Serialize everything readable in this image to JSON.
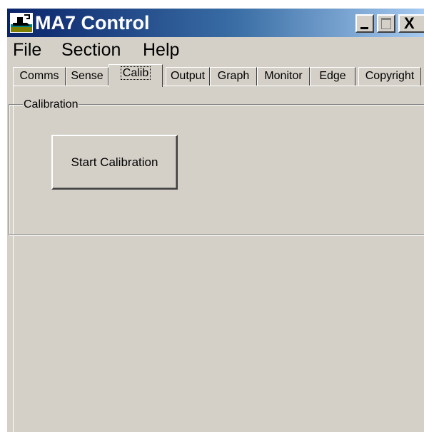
{
  "window": {
    "title": "MA7 Control",
    "app_icon": "ma7-app-icon",
    "controls": {
      "minimize_icon": "minimize-icon",
      "maximize_icon": "maximize-icon",
      "close_label": "X"
    }
  },
  "menu": {
    "items": [
      {
        "label": "File"
      },
      {
        "label": "Section"
      },
      {
        "label": "Help"
      }
    ]
  },
  "tabs": {
    "active": "Calib",
    "items": [
      {
        "label": "Comms"
      },
      {
        "label": "Sense"
      },
      {
        "label": "Calib"
      },
      {
        "label": "Output"
      },
      {
        "label": "Graph"
      },
      {
        "label": "Monitor"
      },
      {
        "label": "Edge"
      },
      {
        "label": "Copyright"
      }
    ]
  },
  "calibration": {
    "group_label": "Calibration",
    "start_button_label": "Start Calibration"
  },
  "colors": {
    "title_start": "#0a246a",
    "title_end": "#a6caf0",
    "face": "#d4d0c8",
    "title_text": "#ffffff"
  }
}
